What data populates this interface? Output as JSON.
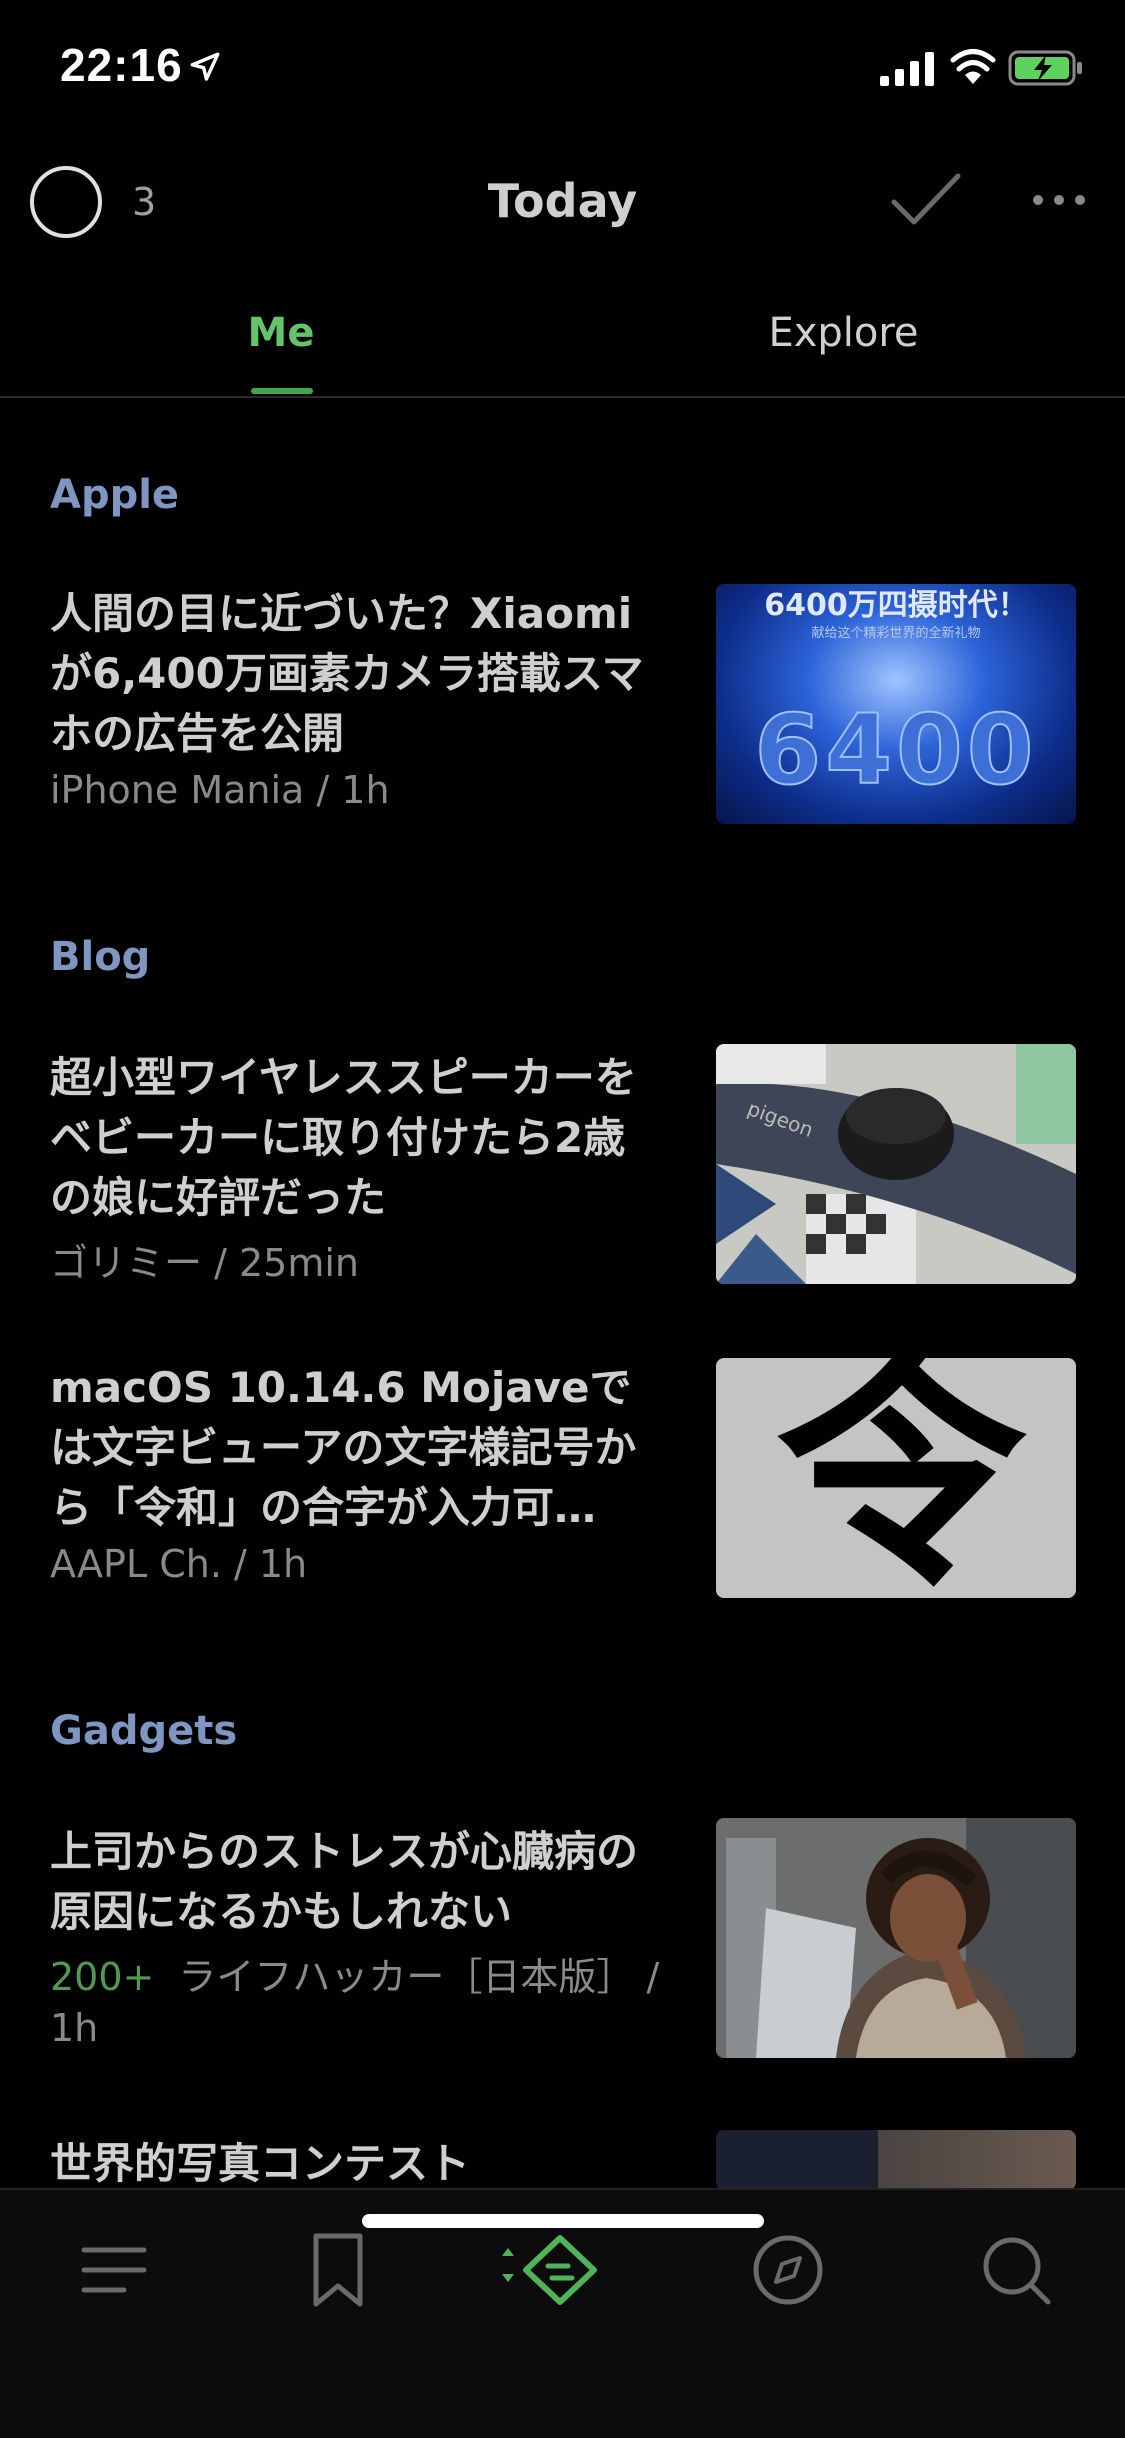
{
  "status_bar": {
    "time": "22:16"
  },
  "header": {
    "unread_count": "3",
    "title": "Today"
  },
  "tabs": [
    {
      "label": "Me",
      "active": true
    },
    {
      "label": "Explore",
      "active": false
    }
  ],
  "sections": [
    {
      "title": "Apple",
      "articles": [
        {
          "title": "人間の目に近づいた？Xiaomiが6,400万画素カメラ搭載スマホの広告を公開",
          "meta": "iPhone Mania / 1h",
          "thumb_text": "6400万四摄时代！",
          "thumb_sub": "献给这个精彩世界的全新礼物",
          "thumb_big": "6400"
        }
      ]
    },
    {
      "title": "Blog",
      "articles": [
        {
          "title": "超小型ワイヤレススピーカーをベビーカーに取り付けたら2歳の娘に好評だった",
          "meta": "ゴリミー / 25min",
          "thumb_text": "pigeon"
        },
        {
          "title": "macOS 10.14.6 Mojaveでは文字ビューアの文字様記号から「令和」の合字が入力可…",
          "meta": "AAPL Ch. / 1h",
          "thumb_text": "令和"
        }
      ]
    },
    {
      "title": "Gadgets",
      "articles": [
        {
          "title": "上司からのストレスが心臓病の原因になるかもしれない",
          "meta_count": "200+",
          "meta": "ライフハッカー［日本版］ /",
          "meta_line2": "1h"
        },
        {
          "title": "世界的写真コンテスト"
        }
      ]
    }
  ],
  "colors": {
    "accent": "#63c46a",
    "section": "#7f96c2",
    "background": "#000000"
  }
}
